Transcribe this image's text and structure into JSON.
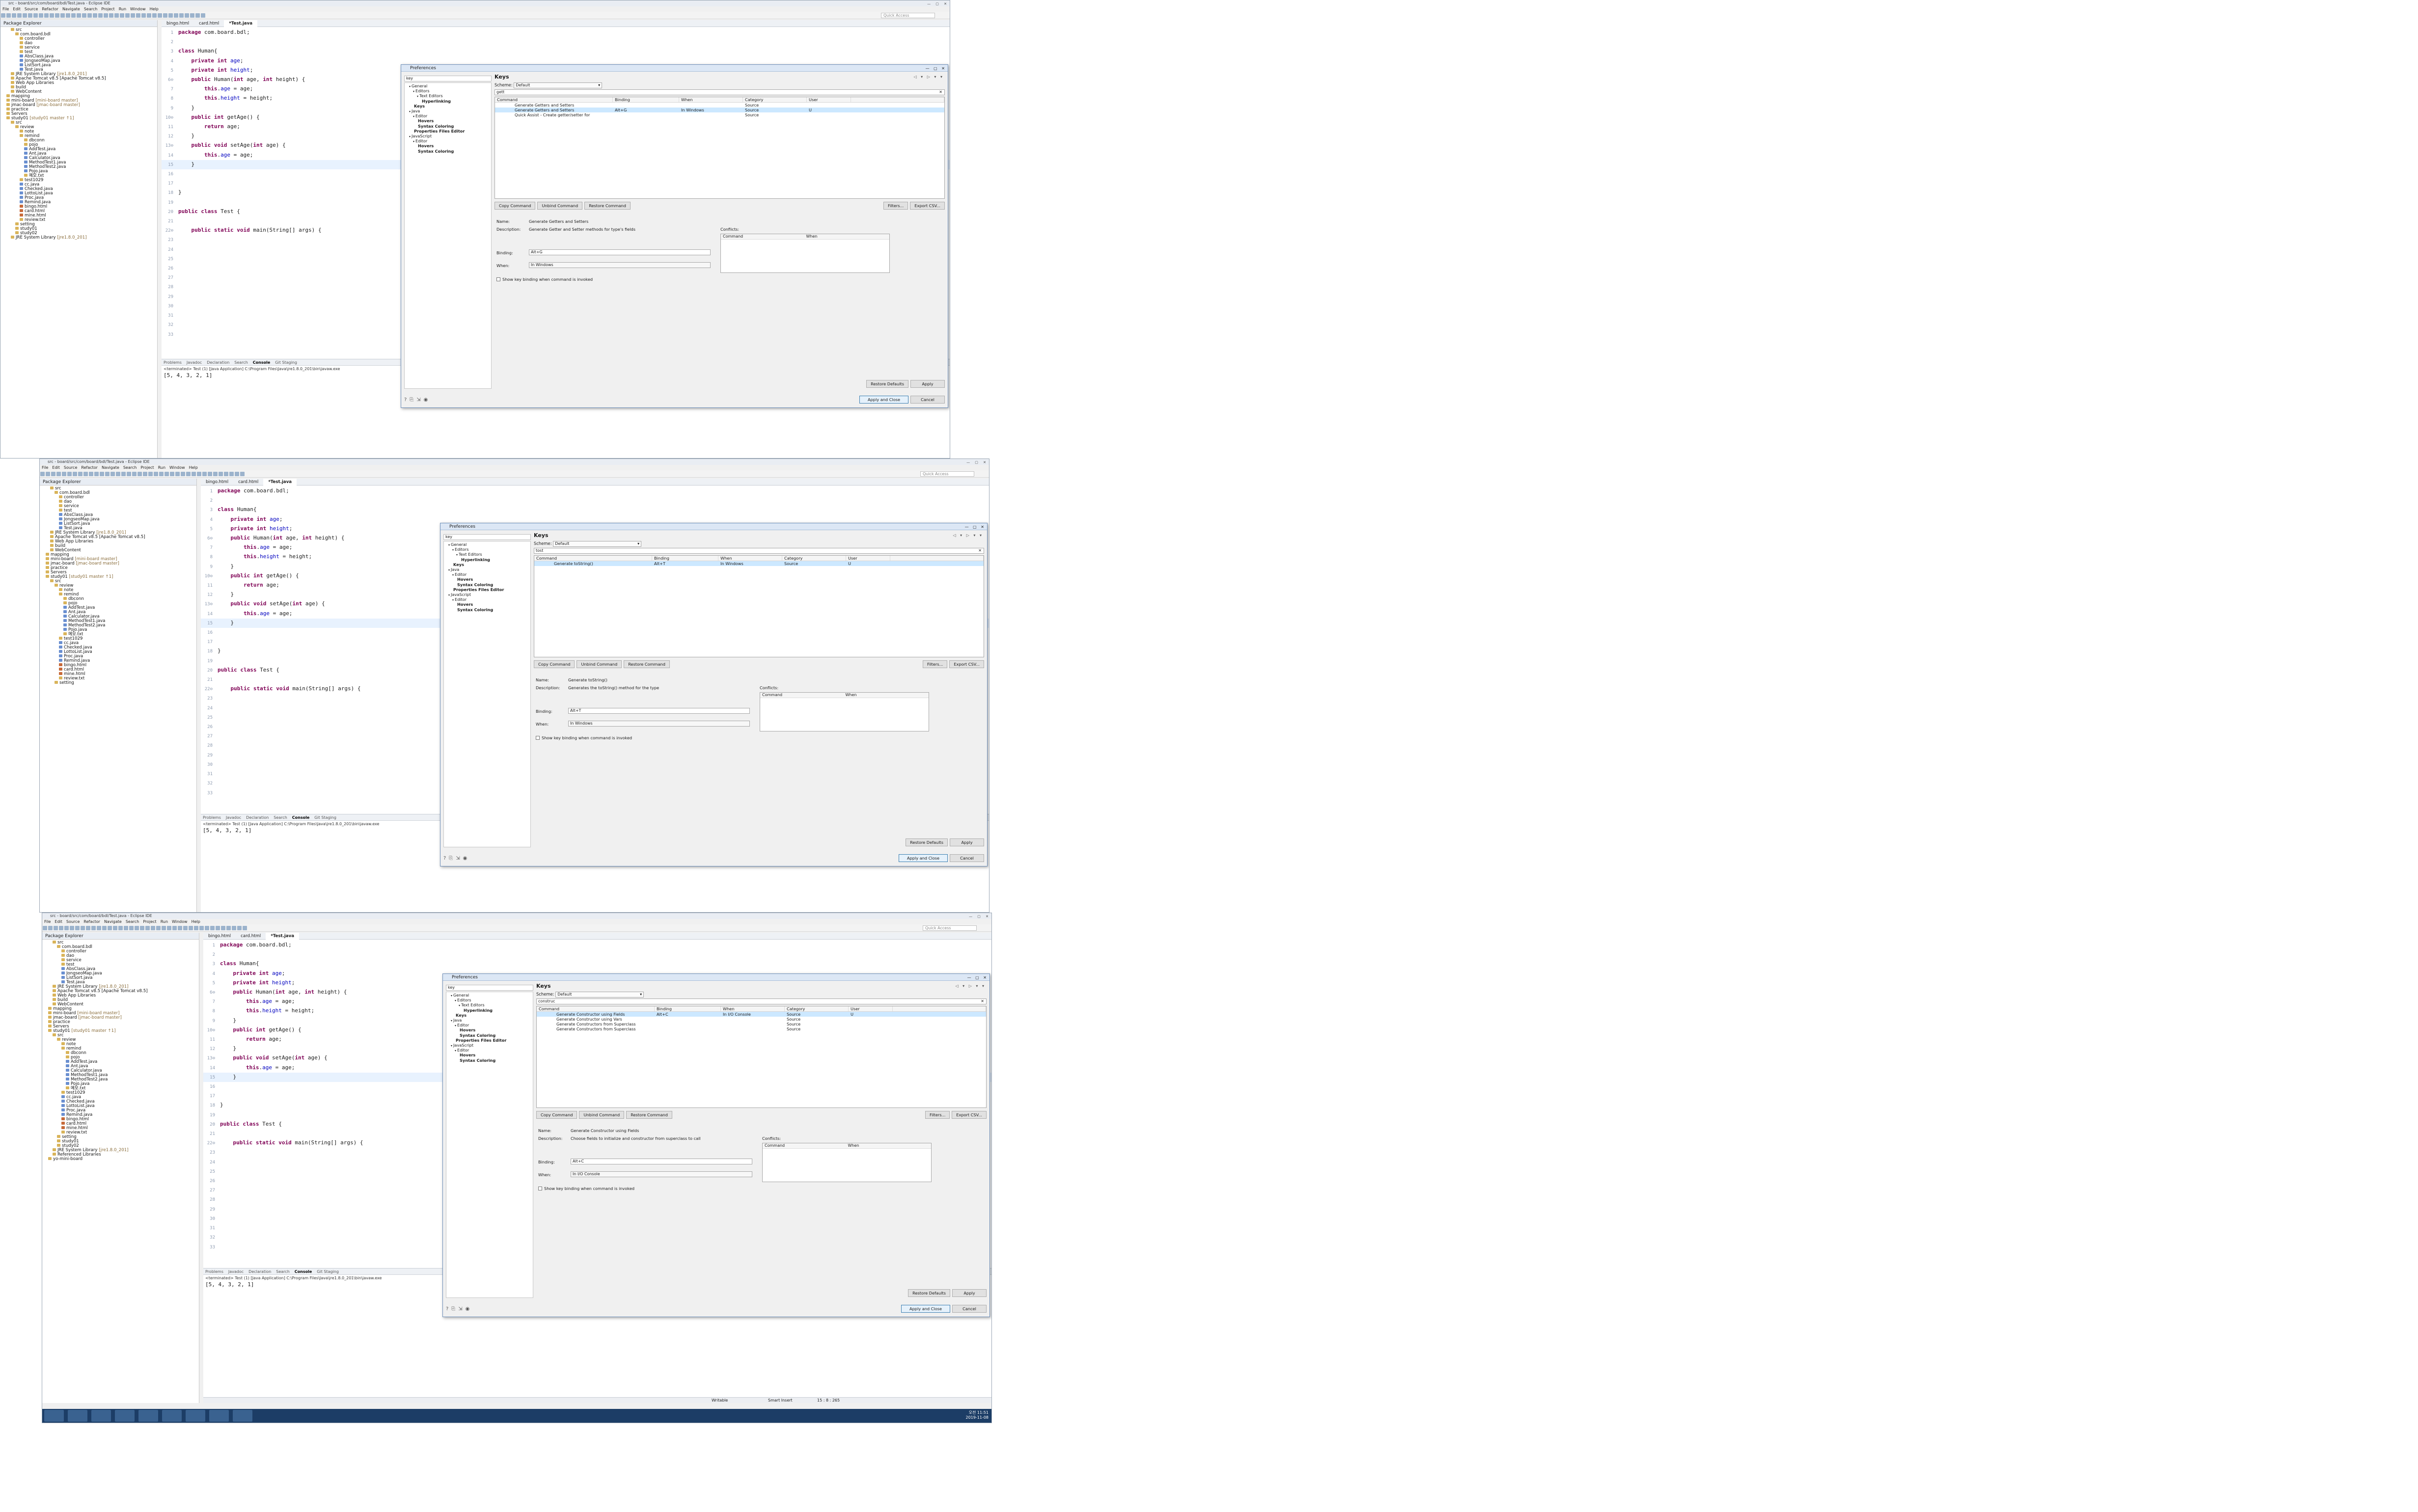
{
  "window_title": "src - board/src/com/board/bdl/Test.java - Eclipse IDE",
  "menu": [
    "File",
    "Edit",
    "Source",
    "Refactor",
    "Navigate",
    "Search",
    "Project",
    "Run",
    "Window",
    "Help"
  ],
  "quick_access": "Quick Access",
  "package_explorer": {
    "title": "Package Explorer",
    "items": [
      {
        "text": "src",
        "icon": "folder"
      },
      {
        "text": "com.board.bdl",
        "icon": "folder"
      },
      {
        "text": "controller",
        "icon": "folder"
      },
      {
        "text": "dao",
        "icon": "folder"
      },
      {
        "text": "service",
        "icon": "folder"
      },
      {
        "text": "test",
        "icon": "folder"
      },
      {
        "text": "AbsClass.java",
        "icon": "java"
      },
      {
        "text": "JongseoMap.java",
        "icon": "java"
      },
      {
        "text": "ListSort.java",
        "icon": "java"
      },
      {
        "text": "Test.java",
        "icon": "java"
      },
      {
        "text": "JRE System Library",
        "meta": "[jre1.8.0_201]",
        "icon": "lib"
      },
      {
        "text": "Apache Tomcat v8.5 [Apache Tomcat v8.5]",
        "icon": "lib"
      },
      {
        "text": "Web App Libraries",
        "icon": "lib"
      },
      {
        "text": "build",
        "icon": "folder"
      },
      {
        "text": "WebContent",
        "icon": "folder"
      },
      {
        "text": "mapping",
        "icon": "folder"
      },
      {
        "text": "mini-board",
        "meta": "[mini-board master]",
        "icon": "folder"
      },
      {
        "text": "jmac-board",
        "meta": "[jmac-board master]",
        "icon": "folder"
      },
      {
        "text": "practice",
        "icon": "folder"
      },
      {
        "text": "Servers",
        "icon": "folder"
      },
      {
        "text": "study01",
        "meta": "[study01 master ↑1]",
        "icon": "folder"
      },
      {
        "text": "src",
        "icon": "folder"
      },
      {
        "text": "review",
        "icon": "folder"
      },
      {
        "text": "note",
        "icon": "folder"
      },
      {
        "text": "remind",
        "icon": "folder"
      },
      {
        "text": "dbconn",
        "icon": "folder"
      },
      {
        "text": "pojo",
        "icon": "folder"
      },
      {
        "text": "AddTest.java",
        "icon": "java"
      },
      {
        "text": "Ant.java",
        "icon": "java"
      },
      {
        "text": "Calculator.java",
        "icon": "java"
      },
      {
        "text": "MethodTest1.java",
        "icon": "java"
      },
      {
        "text": "MethodTest2.java",
        "icon": "java"
      },
      {
        "text": "Pojo.java",
        "icon": "java"
      },
      {
        "text": "메모.txt",
        "icon": "file"
      },
      {
        "text": "test1029",
        "icon": "folder"
      },
      {
        "text": "cc.java",
        "icon": "java"
      },
      {
        "text": "Checked.java",
        "icon": "java"
      },
      {
        "text": "LottoList.java",
        "icon": "java"
      },
      {
        "text": "Proc.java",
        "icon": "java"
      },
      {
        "text": "Remind.java",
        "icon": "java"
      },
      {
        "text": "bingo.html",
        "icon": "html"
      },
      {
        "text": "card.html",
        "icon": "html"
      },
      {
        "text": "mine.html",
        "icon": "html"
      },
      {
        "text": "review.txt",
        "icon": "file"
      },
      {
        "text": "setting",
        "icon": "folder"
      },
      {
        "text": "study01",
        "icon": "folder"
      },
      {
        "text": "study02",
        "icon": "folder"
      },
      {
        "text": "JRE System Library",
        "meta": "[jre1.8.0_201]",
        "icon": "lib"
      },
      {
        "text": "Referenced Libraries",
        "icon": "lib"
      },
      {
        "text": "yo-mini-board",
        "icon": "folder"
      }
    ]
  },
  "editor_tabs": [
    "bingo.html",
    "card.html",
    "*Test.java"
  ],
  "code_lines": [
    {
      "n": "1",
      "t": "package com.board.bdl;"
    },
    {
      "n": "2",
      "t": ""
    },
    {
      "n": "3",
      "t": "class Human{"
    },
    {
      "n": "4",
      "t": "    private int age;"
    },
    {
      "n": "5",
      "t": "    private int height;"
    },
    {
      "n": "6⊖",
      "t": "    public Human(int age, int height) {"
    },
    {
      "n": "7",
      "t": "        this.age = age;"
    },
    {
      "n": "8",
      "t": "        this.height = height;"
    },
    {
      "n": "9",
      "t": "    }"
    },
    {
      "n": "10⊖",
      "t": "    public int getAge() {"
    },
    {
      "n": "11",
      "t": "        return age;"
    },
    {
      "n": "12",
      "t": "    }"
    },
    {
      "n": "13⊖",
      "t": "    public void setAge(int age) {"
    },
    {
      "n": "14",
      "t": "        this.age = age;"
    },
    {
      "n": "15",
      "t": "    }"
    },
    {
      "n": "16",
      "t": ""
    },
    {
      "n": "17",
      "t": ""
    },
    {
      "n": "18",
      "t": "}"
    },
    {
      "n": "19",
      "t": ""
    },
    {
      "n": "20",
      "t": "public class Test {"
    },
    {
      "n": "21",
      "t": ""
    },
    {
      "n": "22⊖",
      "t": "    public static void main(String[] args) {"
    },
    {
      "n": "23",
      "t": ""
    },
    {
      "n": "24",
      "t": ""
    },
    {
      "n": "25",
      "t": ""
    },
    {
      "n": "26",
      "t": ""
    },
    {
      "n": "27",
      "t": ""
    },
    {
      "n": "28",
      "t": ""
    },
    {
      "n": "29",
      "t": ""
    },
    {
      "n": "30",
      "t": ""
    },
    {
      "n": "31",
      "t": ""
    },
    {
      "n": "32",
      "t": ""
    },
    {
      "n": "33",
      "t": ""
    }
  ],
  "console": {
    "tabs": [
      "Problems",
      "Javadoc",
      "Declaration",
      "Search",
      "Console",
      "Git Staging"
    ],
    "terminated": "<terminated> Test (1) [Java Application] C:\\Program Files\\Java\\jre1.8.0_201\\bin\\javaw.exe",
    "output": "[5, 4, 3, 2, 1]"
  },
  "dialog_common": {
    "title": "Preferences",
    "filter": "key",
    "tree": [
      {
        "text": "General",
        "indent": 0,
        "bold": false
      },
      {
        "text": "Editors",
        "indent": 1,
        "bold": false
      },
      {
        "text": "Text Editors",
        "indent": 2,
        "bold": false
      },
      {
        "text": "Hyperlinking",
        "indent": 3,
        "bold": true
      },
      {
        "text": "Keys",
        "indent": 1,
        "bold": true
      },
      {
        "text": "Java",
        "indent": 0,
        "bold": false
      },
      {
        "text": "Editor",
        "indent": 1,
        "bold": false
      },
      {
        "text": "Hovers",
        "indent": 2,
        "bold": true
      },
      {
        "text": "Syntax Coloring",
        "indent": 2,
        "bold": true
      },
      {
        "text": "Properties Files Editor",
        "indent": 1,
        "bold": true
      },
      {
        "text": "JavaScript",
        "indent": 0,
        "bold": false
      },
      {
        "text": "Editor",
        "indent": 1,
        "bold": false
      },
      {
        "text": "Hovers",
        "indent": 2,
        "bold": true
      },
      {
        "text": "Syntax Coloring",
        "indent": 2,
        "bold": true
      }
    ],
    "page_title": "Keys",
    "scheme_label": "Scheme:",
    "scheme_value": "Default",
    "columns": [
      "Command",
      "Binding",
      "When",
      "Category",
      "User"
    ],
    "buttons_mid": [
      "Copy Command",
      "Unbind Command",
      "Restore Command"
    ],
    "buttons_mid_right": [
      "Filters...",
      "Export CSV..."
    ],
    "name_label": "Name:",
    "desc_label": "Description:",
    "binding_label": "Binding:",
    "when_label": "When:",
    "conflicts_label": "Conflicts:",
    "conflicts_cols": [
      "Command",
      "When"
    ],
    "show_key_binding": "Show key binding when command is invoked",
    "restore_defaults": "Restore Defaults",
    "apply": "Apply",
    "apply_close": "Apply and Close",
    "cancel": "Cancel"
  },
  "dialogs": [
    {
      "search": "gett",
      "rows": [
        {
          "cmd": "Generate Getters and Setters",
          "binding": "",
          "when": "",
          "cat": "Source",
          "user": ""
        },
        {
          "cmd": "Generate Getters and Setters",
          "binding": "Alt+G",
          "when": "In Windows",
          "cat": "Source",
          "user": "U"
        },
        {
          "cmd": "Quick Assist - Create getter/setter for",
          "binding": "",
          "when": "",
          "cat": "Source",
          "user": ""
        }
      ],
      "name": "Generate Getters and Setters",
      "description": "Generate Getter and Setter methods for type's fields",
      "binding": "Alt+G",
      "when": "In Windows"
    },
    {
      "search": "tost",
      "rows": [
        {
          "cmd": "Generate toString()",
          "binding": "Alt+T",
          "when": "In Windows",
          "cat": "Source",
          "user": "U"
        }
      ],
      "name": "Generate toString()",
      "description": "Generates the toString() method for the type",
      "binding": "Alt+T",
      "when": "In Windows"
    },
    {
      "search": "construc",
      "rows": [
        {
          "cmd": "Generate Constructor using Fields",
          "binding": "Alt+C",
          "when": "In I/O Console",
          "cat": "Source",
          "user": "U"
        },
        {
          "cmd": "Generate Constructor using Vars",
          "binding": "",
          "when": "",
          "cat": "Source",
          "user": ""
        },
        {
          "cmd": "Generate Constructors from Superclass",
          "binding": "",
          "when": "",
          "cat": "Source",
          "user": ""
        },
        {
          "cmd": "Generate Constructors from Superclass",
          "binding": "",
          "when": "",
          "cat": "Source",
          "user": ""
        }
      ],
      "name": "Generate Constructor using Fields",
      "description": "Choose fields to initialize and constructor from superclass to call",
      "binding": "Alt+C",
      "when": "In I/O Console"
    }
  ],
  "status": {
    "writable": "Writable",
    "insert": "Smart Insert",
    "position": "15 : 8 : 265"
  },
  "tray": {
    "time": "오전 11:51",
    "date": "2019-11-08"
  },
  "colors": {
    "keyword": "#7f0055",
    "field": "#0000c0",
    "selection": "#cce8ff",
    "dialog_border": "#6e8fb9"
  }
}
